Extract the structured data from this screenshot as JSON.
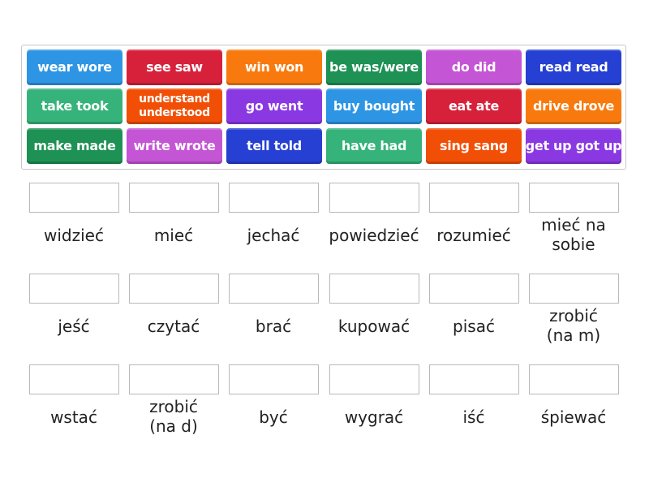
{
  "activity": {
    "type": "match-up",
    "tiles": [
      {
        "text": "wear wore",
        "color": "#2e95e4"
      },
      {
        "text": "see saw",
        "color": "#d7213b"
      },
      {
        "text": "win won",
        "color": "#f87a0e"
      },
      {
        "text": "be was/were",
        "color": "#1e9154"
      },
      {
        "text": "do did",
        "color": "#c455d4"
      },
      {
        "text": "read read",
        "color": "#2640d3"
      },
      {
        "text": "take took",
        "color": "#36b37a"
      },
      {
        "text": "understand understood",
        "color": "#f14f06"
      },
      {
        "text": "go went",
        "color": "#8a38e2"
      },
      {
        "text": "buy bought",
        "color": "#2e95e4"
      },
      {
        "text": "eat ate",
        "color": "#d7213b"
      },
      {
        "text": "drive drove",
        "color": "#f87a0e"
      },
      {
        "text": "make made",
        "color": "#1e9154"
      },
      {
        "text": "write wrote",
        "color": "#c455d4"
      },
      {
        "text": "tell told",
        "color": "#2640d3"
      },
      {
        "text": "have had",
        "color": "#36b37a"
      },
      {
        "text": "sing sang",
        "color": "#f14f06"
      },
      {
        "text": "get up got up",
        "color": "#8a38e2"
      }
    ],
    "targets": [
      {
        "label": "widzieć",
        "answer": ""
      },
      {
        "label": "mieć",
        "answer": ""
      },
      {
        "label": "jechać",
        "answer": ""
      },
      {
        "label": "powiedzieć",
        "answer": ""
      },
      {
        "label": "rozumieć",
        "answer": ""
      },
      {
        "label": "mieć na\nsobie",
        "answer": ""
      },
      {
        "label": "jeść",
        "answer": ""
      },
      {
        "label": "czytać",
        "answer": ""
      },
      {
        "label": "brać",
        "answer": ""
      },
      {
        "label": "kupować",
        "answer": ""
      },
      {
        "label": "pisać",
        "answer": ""
      },
      {
        "label": "zrobić\n(na m)",
        "answer": ""
      },
      {
        "label": "wstać",
        "answer": ""
      },
      {
        "label": "zrobić\n(na d)",
        "answer": ""
      },
      {
        "label": "być",
        "answer": ""
      },
      {
        "label": "wygrać",
        "answer": ""
      },
      {
        "label": "iść",
        "answer": ""
      },
      {
        "label": "śpiewać",
        "answer": ""
      }
    ]
  }
}
